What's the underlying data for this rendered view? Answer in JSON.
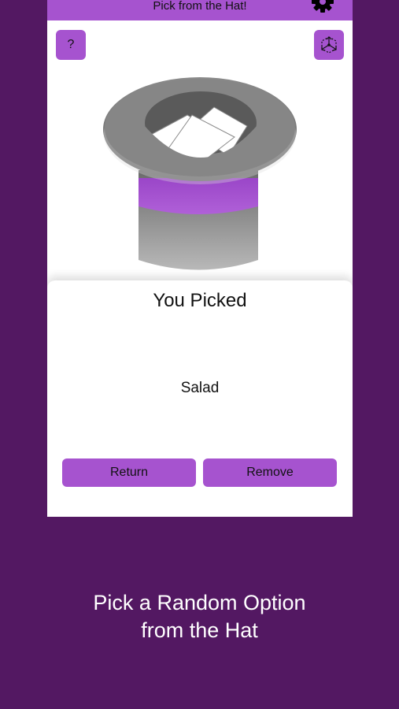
{
  "app": {
    "title": "Pick from the Hat!",
    "accent_color": "#a653cf",
    "background_color": "#531862"
  },
  "toolbar": {
    "help_label": "?",
    "settings_icon": "gear-icon",
    "shuffle_icon": "shuffle-icon"
  },
  "result_card": {
    "heading": "You Picked",
    "picked_item": "Salad",
    "return_label": "Return",
    "remove_label": "Remove"
  },
  "promo": {
    "caption_line1": "Pick a Random Option",
    "caption_line2": "from the Hat"
  }
}
